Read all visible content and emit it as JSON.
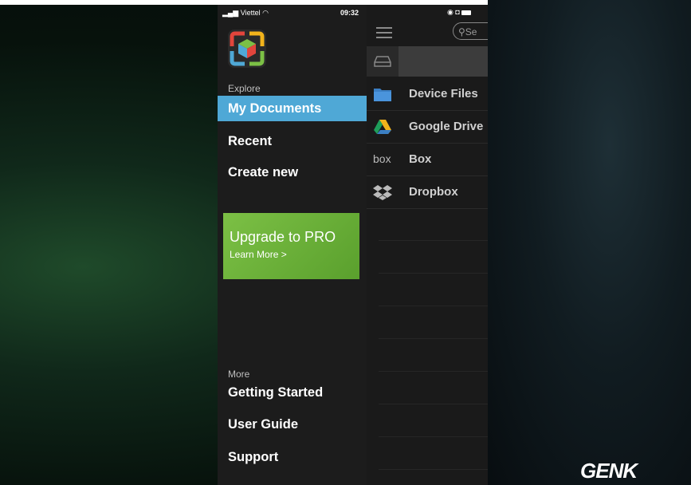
{
  "status_bar": {
    "carrier": "Viettel",
    "time": "09:32"
  },
  "drawer": {
    "explore_label": "Explore",
    "items": [
      {
        "label": "My Documents",
        "active": true
      },
      {
        "label": "Recent"
      },
      {
        "label": "Create new"
      }
    ],
    "promo": {
      "title": "Upgrade to PRO",
      "link": "Learn More >"
    },
    "more_label": "More",
    "more_items": [
      {
        "label": "Getting Started"
      },
      {
        "label": "User Guide"
      },
      {
        "label": "Support"
      }
    ]
  },
  "file_panel": {
    "search_placeholder": "Se",
    "locations": [
      {
        "label": "Device Files",
        "icon": "folder-icon"
      },
      {
        "label": "Google Drive",
        "icon": "google-drive-icon"
      },
      {
        "label": "Box",
        "icon": "box-icon",
        "icon_text": "box"
      },
      {
        "label": "Dropbox",
        "icon": "dropbox-icon"
      }
    ]
  },
  "watermark": {
    "text": "GENK"
  },
  "colors": {
    "active": "#4fa8d6",
    "promo": "#6ab23a",
    "drawer_bg": "#1c1c1c"
  }
}
